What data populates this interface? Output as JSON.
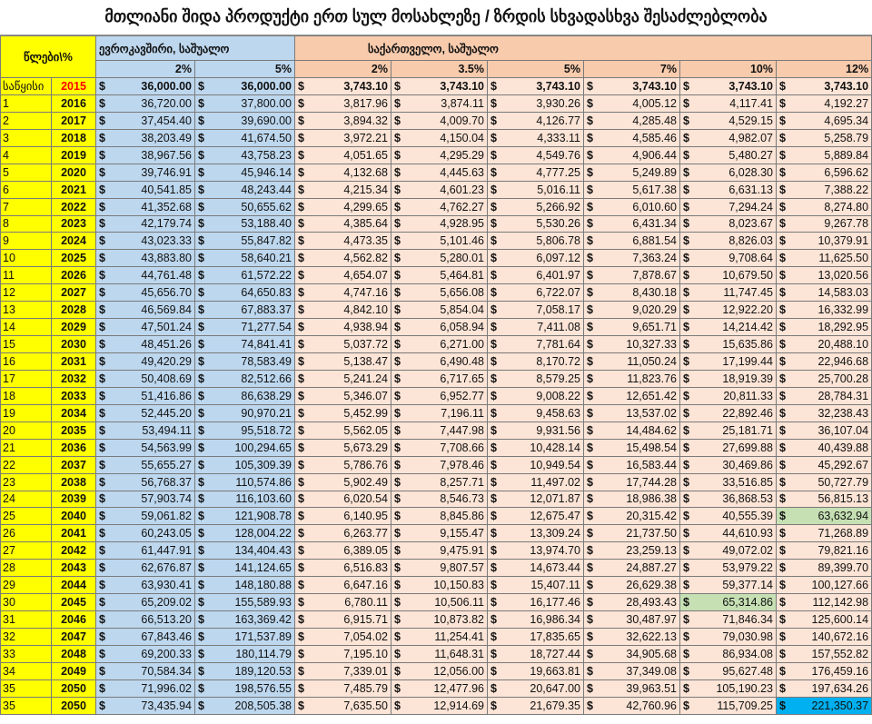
{
  "title": "მთლიანი შიდა პროდუქტი ერთ სულ მოსახლეზე / ზრდის სხვადასხვა შესაძლებლობა",
  "header": {
    "years_label": "წლები\\%",
    "eu_group": "ევროკავშირი, საშუალო",
    "ge_group": "საქართველო, საშუალო",
    "eu_rates": [
      "2%",
      "5%"
    ],
    "ge_rates": [
      "2%",
      "3.5%",
      "5%",
      "7%",
      "10%",
      "12%"
    ]
  },
  "currency": "$",
  "colors": {
    "year_col": "#ffff00",
    "eu": "#bdd7ee",
    "ge": "#fce4d6",
    "highlight": "#c6e0b4",
    "max_highlight": "#00b0f0",
    "base_text": "#ff0000"
  },
  "rows": [
    {
      "idx": "საწყისი",
      "year": "2015",
      "eu": [
        "36,000.00",
        "36,000.00"
      ],
      "ge": [
        "3,743.10",
        "3,743.10",
        "3,743.10",
        "3,743.10",
        "3,743.10",
        "3,743.10"
      ]
    },
    {
      "idx": "1",
      "year": "2016",
      "eu": [
        "36,720.00",
        "37,800.00"
      ],
      "ge": [
        "3,817.96",
        "3,874.11",
        "3,930.26",
        "4,005.12",
        "4,117.41",
        "4,192.27"
      ]
    },
    {
      "idx": "2",
      "year": "2017",
      "eu": [
        "37,454.40",
        "39,690.00"
      ],
      "ge": [
        "3,894.32",
        "4,009.70",
        "4,126.77",
        "4,285.48",
        "4,529.15",
        "4,695.34"
      ]
    },
    {
      "idx": "3",
      "year": "2018",
      "eu": [
        "38,203.49",
        "41,674.50"
      ],
      "ge": [
        "3,972.21",
        "4,150.04",
        "4,333.11",
        "4,585.46",
        "4,982.07",
        "5,258.79"
      ]
    },
    {
      "idx": "4",
      "year": "2019",
      "eu": [
        "38,967.56",
        "43,758.23"
      ],
      "ge": [
        "4,051.65",
        "4,295.29",
        "4,549.76",
        "4,906.44",
        "5,480.27",
        "5,889.84"
      ]
    },
    {
      "idx": "5",
      "year": "2020",
      "eu": [
        "39,746.91",
        "45,946.14"
      ],
      "ge": [
        "4,132.68",
        "4,445.63",
        "4,777.25",
        "5,249.89",
        "6,028.30",
        "6,596.62"
      ]
    },
    {
      "idx": "6",
      "year": "2021",
      "eu": [
        "40,541.85",
        "48,243.44"
      ],
      "ge": [
        "4,215.34",
        "4,601.23",
        "5,016.11",
        "5,617.38",
        "6,631.13",
        "7,388.22"
      ]
    },
    {
      "idx": "7",
      "year": "2022",
      "eu": [
        "41,352.68",
        "50,655.62"
      ],
      "ge": [
        "4,299.65",
        "4,762.27",
        "5,266.92",
        "6,010.60",
        "7,294.24",
        "8,274.80"
      ]
    },
    {
      "idx": "8",
      "year": "2023",
      "eu": [
        "42,179.74",
        "53,188.40"
      ],
      "ge": [
        "4,385.64",
        "4,928.95",
        "5,530.26",
        "6,431.34",
        "8,023.67",
        "9,267.78"
      ]
    },
    {
      "idx": "9",
      "year": "2024",
      "eu": [
        "43,023.33",
        "55,847.82"
      ],
      "ge": [
        "4,473.35",
        "5,101.46",
        "5,806.78",
        "6,881.54",
        "8,826.03",
        "10,379.91"
      ]
    },
    {
      "idx": "10",
      "year": "2025",
      "eu": [
        "43,883.80",
        "58,640.21"
      ],
      "ge": [
        "4,562.82",
        "5,280.01",
        "6,097.12",
        "7,363.24",
        "9,708.64",
        "11,625.50"
      ]
    },
    {
      "idx": "11",
      "year": "2026",
      "eu": [
        "44,761.48",
        "61,572.22"
      ],
      "ge": [
        "4,654.07",
        "5,464.81",
        "6,401.97",
        "7,878.67",
        "10,679.50",
        "13,020.56"
      ]
    },
    {
      "idx": "12",
      "year": "2027",
      "eu": [
        "45,656.70",
        "64,650.83"
      ],
      "ge": [
        "4,747.16",
        "5,656.08",
        "6,722.07",
        "8,430.18",
        "11,747.45",
        "14,583.03"
      ]
    },
    {
      "idx": "13",
      "year": "2028",
      "eu": [
        "46,569.84",
        "67,883.37"
      ],
      "ge": [
        "4,842.10",
        "5,854.04",
        "7,058.17",
        "9,020.29",
        "12,922.20",
        "16,332.99"
      ]
    },
    {
      "idx": "14",
      "year": "2029",
      "eu": [
        "47,501.24",
        "71,277.54"
      ],
      "ge": [
        "4,938.94",
        "6,058.94",
        "7,411.08",
        "9,651.71",
        "14,214.42",
        "18,292.95"
      ]
    },
    {
      "idx": "15",
      "year": "2030",
      "eu": [
        "48,451.26",
        "74,841.41"
      ],
      "ge": [
        "5,037.72",
        "6,271.00",
        "7,781.64",
        "10,327.33",
        "15,635.86",
        "20,488.10"
      ]
    },
    {
      "idx": "16",
      "year": "2031",
      "eu": [
        "49,420.29",
        "78,583.49"
      ],
      "ge": [
        "5,138.47",
        "6,490.48",
        "8,170.72",
        "11,050.24",
        "17,199.44",
        "22,946.68"
      ]
    },
    {
      "idx": "17",
      "year": "2032",
      "eu": [
        "50,408.69",
        "82,512.66"
      ],
      "ge": [
        "5,241.24",
        "6,717.65",
        "8,579.25",
        "11,823.76",
        "18,919.39",
        "25,700.28"
      ]
    },
    {
      "idx": "18",
      "year": "2033",
      "eu": [
        "51,416.86",
        "86,638.29"
      ],
      "ge": [
        "5,346.07",
        "6,952.77",
        "9,008.22",
        "12,651.42",
        "20,811.33",
        "28,784.31"
      ]
    },
    {
      "idx": "19",
      "year": "2034",
      "eu": [
        "52,445.20",
        "90,970.21"
      ],
      "ge": [
        "5,452.99",
        "7,196.11",
        "9,458.63",
        "13,537.02",
        "22,892.46",
        "32,238.43"
      ]
    },
    {
      "idx": "20",
      "year": "2035",
      "eu": [
        "53,494.11",
        "95,518.72"
      ],
      "ge": [
        "5,562.05",
        "7,447.98",
        "9,931.56",
        "14,484.62",
        "25,181.71",
        "36,107.04"
      ]
    },
    {
      "idx": "21",
      "year": "2036",
      "eu": [
        "54,563.99",
        "100,294.65"
      ],
      "ge": [
        "5,673.29",
        "7,708.66",
        "10,428.14",
        "15,498.54",
        "27,699.88",
        "40,439.88"
      ]
    },
    {
      "idx": "22",
      "year": "2037",
      "eu": [
        "55,655.27",
        "105,309.39"
      ],
      "ge": [
        "5,786.76",
        "7,978.46",
        "10,949.54",
        "16,583.44",
        "30,469.86",
        "45,292.67"
      ]
    },
    {
      "idx": "23",
      "year": "2038",
      "eu": [
        "56,768.37",
        "110,574.86"
      ],
      "ge": [
        "5,902.49",
        "8,257.71",
        "11,497.02",
        "17,744.28",
        "33,516.85",
        "50,727.79"
      ]
    },
    {
      "idx": "24",
      "year": "2039",
      "eu": [
        "57,903.74",
        "116,103.60"
      ],
      "ge": [
        "6,020.54",
        "8,546.73",
        "12,071.87",
        "18,986.38",
        "36,868.53",
        "56,815.13"
      ]
    },
    {
      "idx": "25",
      "year": "2040",
      "eu": [
        "59,061.82",
        "121,908.78"
      ],
      "ge": [
        "6,140.95",
        "8,845.86",
        "12,675.47",
        "20,315.42",
        "40,555.39",
        "63,632.94"
      ],
      "hl": [
        5
      ]
    },
    {
      "idx": "26",
      "year": "2041",
      "eu": [
        "60,243.05",
        "128,004.22"
      ],
      "ge": [
        "6,263.77",
        "9,155.47",
        "13,309.24",
        "21,737.50",
        "44,610.93",
        "71,268.89"
      ]
    },
    {
      "idx": "27",
      "year": "2042",
      "eu": [
        "61,447.91",
        "134,404.43"
      ],
      "ge": [
        "6,389.05",
        "9,475.91",
        "13,974.70",
        "23,259.13",
        "49,072.02",
        "79,821.16"
      ]
    },
    {
      "idx": "28",
      "year": "2043",
      "eu": [
        "62,676.87",
        "141,124.65"
      ],
      "ge": [
        "6,516.83",
        "9,807.57",
        "14,673.44",
        "24,887.27",
        "53,979.22",
        "89,399.70"
      ]
    },
    {
      "idx": "29",
      "year": "2044",
      "eu": [
        "63,930.41",
        "148,180.88"
      ],
      "ge": [
        "6,647.16",
        "10,150.83",
        "15,407.11",
        "26,629.38",
        "59,377.14",
        "100,127.66"
      ]
    },
    {
      "idx": "30",
      "year": "2045",
      "eu": [
        "65,209.02",
        "155,589.93"
      ],
      "ge": [
        "6,780.11",
        "10,506.11",
        "16,177.46",
        "28,493.43",
        "65,314.86",
        "112,142.98"
      ],
      "hl": [
        4
      ]
    },
    {
      "idx": "31",
      "year": "2046",
      "eu": [
        "66,513.20",
        "163,369.42"
      ],
      "ge": [
        "6,915.71",
        "10,873.82",
        "16,986.34",
        "30,487.97",
        "71,846.34",
        "125,600.14"
      ]
    },
    {
      "idx": "32",
      "year": "2047",
      "eu": [
        "67,843.46",
        "171,537.89"
      ],
      "ge": [
        "7,054.02",
        "11,254.41",
        "17,835.65",
        "32,622.13",
        "79,030.98",
        "140,672.16"
      ]
    },
    {
      "idx": "33",
      "year": "2048",
      "eu": [
        "69,200.33",
        "180,114.79"
      ],
      "ge": [
        "7,195.10",
        "11,648.31",
        "18,727.44",
        "34,905.68",
        "86,934.08",
        "157,552.82"
      ]
    },
    {
      "idx": "34",
      "year": "2049",
      "eu": [
        "70,584.34",
        "189,120.53"
      ],
      "ge": [
        "7,339.01",
        "12,056.00",
        "19,663.81",
        "37,349.08",
        "95,627.48",
        "176,459.16"
      ]
    },
    {
      "idx": "35",
      "year": "2050",
      "eu": [
        "71,996.02",
        "198,576.55"
      ],
      "ge": [
        "7,485.79",
        "12,477.96",
        "20,647.00",
        "39,963.51",
        "105,190.23",
        "197,634.26"
      ]
    },
    {
      "idx": "35",
      "year": "2050",
      "eu": [
        "73,435.94",
        "208,505.38"
      ],
      "ge": [
        "7,635.50",
        "12,914.69",
        "21,679.35",
        "42,760.96",
        "115,709.25",
        "221,350.37"
      ],
      "max": [
        5
      ]
    }
  ]
}
